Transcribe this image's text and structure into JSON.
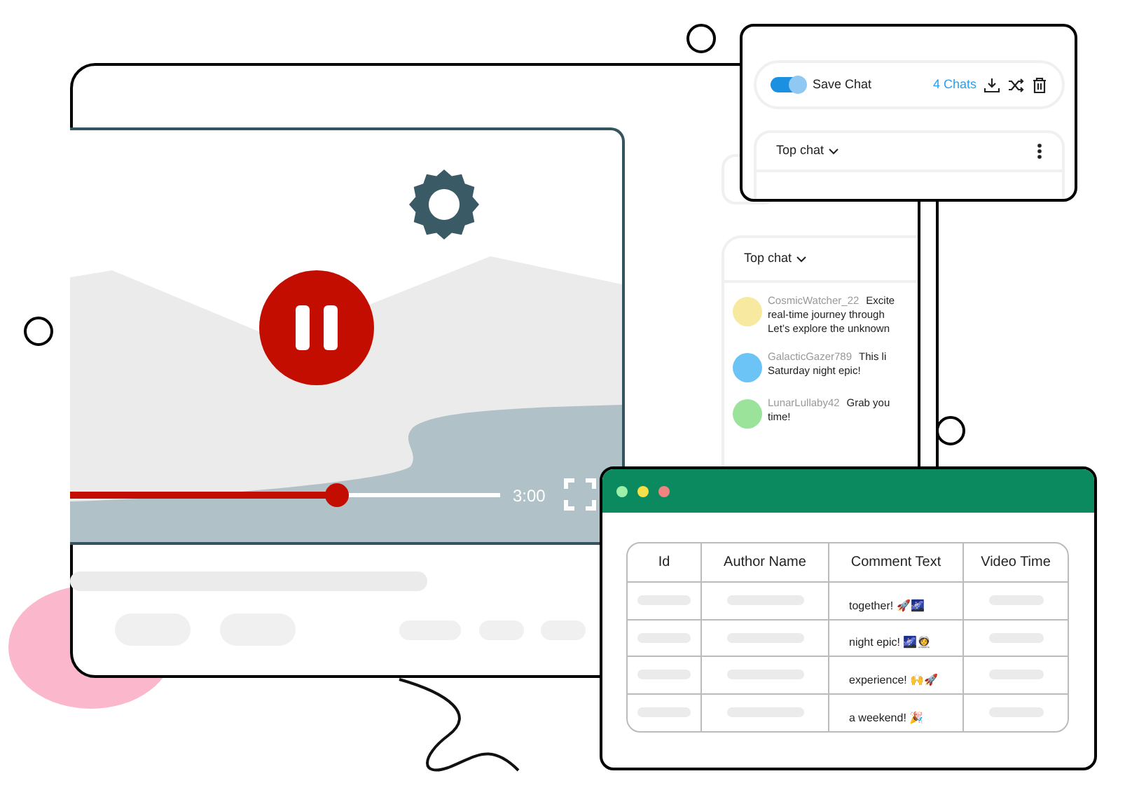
{
  "video": {
    "time": "3:00",
    "level": 0.62,
    "paused": true
  },
  "chat_settings": {
    "save_chat": {
      "label": "Save Chat",
      "on": true
    },
    "count": "4 Chats",
    "sort": "Top chat"
  },
  "chat_feed": {
    "sort": "Top chat",
    "messages": [
      {
        "author": "CosmicWatcher_22",
        "color": "#f7e9a0",
        "first": "Excite",
        "lines": [
          "real-time journey through",
          "Let’s explore the unknown"
        ]
      },
      {
        "author": "GalacticGazer789",
        "color": "#6cc3f5",
        "first": "This li",
        "lines": [
          "Saturday night epic!"
        ]
      },
      {
        "author": "LunarLullaby42",
        "color": "#9be39b",
        "first": "Grab you",
        "lines": [
          "time!"
        ]
      }
    ]
  },
  "table": {
    "columns": [
      "Id",
      "Author Name",
      "Comment Text",
      "Video Time"
    ],
    "rows": [
      {
        "comment": "together! 🚀🌌"
      },
      {
        "comment": "night epic! 🌌👩‍🚀"
      },
      {
        "comment": "experience! 🙌🚀"
      },
      {
        "comment": "a weekend! 🎉"
      }
    ]
  }
}
